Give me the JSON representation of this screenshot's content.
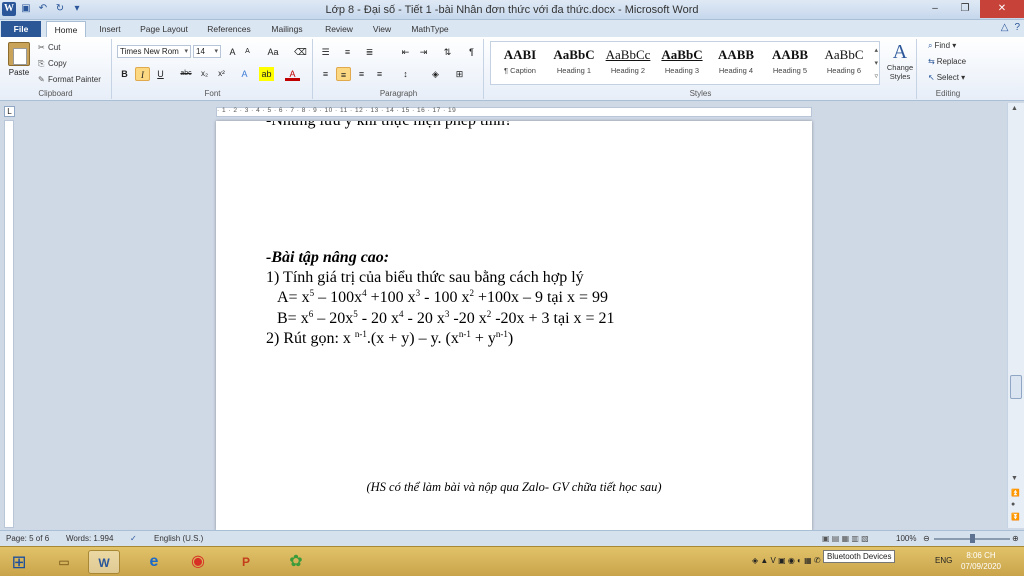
{
  "window": {
    "title": "Lớp 8 - Đại số  - Tiết 1 -bài Nhân đơn thức với đa thức.docx - Microsoft Word",
    "minimize": "–",
    "maximize": "❐",
    "close": "✕"
  },
  "tabs": [
    "File",
    "Home",
    "Insert",
    "Page Layout",
    "References",
    "Mailings",
    "Review",
    "View",
    "MathType"
  ],
  "clipboard": {
    "paste": "Paste",
    "cut": "Cut",
    "copy": "Copy",
    "format_painter": "Format Painter",
    "label": "Clipboard"
  },
  "font": {
    "name": "Times New Rom",
    "size": "14",
    "grow": "A",
    "shrink": "A",
    "case": "Aa",
    "bold": "B",
    "italic": "I",
    "underline": "U",
    "strike": "abc",
    "subscript": "x₂",
    "superscript": "x²",
    "label": "Font"
  },
  "paragraph": {
    "label": "Paragraph",
    "show_marks": "¶"
  },
  "styles": {
    "label": "Styles",
    "items": [
      {
        "preview": "AABI",
        "name": "¶ Caption"
      },
      {
        "preview": "AaBbC",
        "name": "Heading 1"
      },
      {
        "preview": "AaBbCc",
        "name": "Heading 2"
      },
      {
        "preview": "AaBbC",
        "name": "Heading 3"
      },
      {
        "preview": "AABB",
        "name": "Heading 4"
      },
      {
        "preview": "AABB",
        "name": "Heading 5"
      },
      {
        "preview": "AaBbC",
        "name": "Heading 6"
      }
    ],
    "change": "Change Styles"
  },
  "editing": {
    "find": "Find",
    "replace": "Replace",
    "select": "Select",
    "label": "Editing"
  },
  "ruler": {
    "numbers": "· 1 · 2 · 3 · 4 · 5 · 6 · 7 · 8 · 9 · 10 · 11 · 12 · 13 · 14 · 15 · 16 · 17 · 19"
  },
  "document": {
    "cut_line": "-Những lưu ý khi thực hiện phép tính?",
    "heading": "-Bài tập nâng cao:",
    "q1": "1) Tính giá trị của biểu thức sau bằng cách hợp lý",
    "a": {
      "p1": "A= x",
      "e1": "5",
      "p2": " – 100x",
      "e2": "4",
      "p3": " +100 x",
      "e3": "3",
      "p4": " - 100 x",
      "e4": "2",
      "p5": " +100x – 9 tại x = 99"
    },
    "b": {
      "p1": "B= x",
      "e1": "6",
      "p2": " – 20x",
      "e2": "5",
      "p3": " - 20 x",
      "e3": "4",
      "p4": " - 20 x",
      "e4": "3",
      "p5": " -20 x",
      "e5": "2",
      "p6": " -20x + 3 tại x = 21"
    },
    "q2": {
      "p1": "2) Rút gọn:    x ",
      "e1": "n-1",
      "p2": ".(x + y) – y. (x",
      "e2": "n-1",
      "p3": " + y",
      "e3": "n-1",
      "p4": ")"
    },
    "note": "(HS có thể làm bài và nộp qua Zalo- GV chữa tiết học sau)"
  },
  "status": {
    "page": "Page: 5 of 6",
    "words": "Words: 1.994",
    "language": "English (U.S.)",
    "zoom": "100%"
  },
  "taskbar": {
    "tooltip": "Bluetooth Devices",
    "lang": "ENG",
    "time": "8:06 CH",
    "date": "07/09/2020"
  },
  "colors": {
    "accent": "#2b579a",
    "file_tab": "#2b5797",
    "taskbar": "#d4b25a"
  }
}
